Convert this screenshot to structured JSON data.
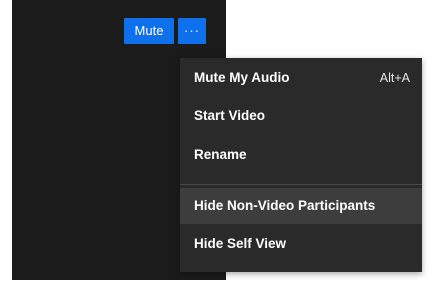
{
  "toolbar": {
    "mute_label": "Mute",
    "more_icon": "more-dots-icon",
    "more_glyph": "···"
  },
  "menu": {
    "items": [
      {
        "label": "Mute My Audio",
        "shortcut": "Alt+A",
        "highlighted": false
      },
      {
        "label": "Start Video",
        "highlighted": false
      },
      {
        "label": "Rename",
        "highlighted": false
      },
      {
        "label": "Hide Non-Video Participants",
        "highlighted": true
      },
      {
        "label": "Hide Self View",
        "highlighted": false
      }
    ]
  },
  "colors": {
    "accent": "#0e71eb",
    "menu_background": "#2a2a2b",
    "menu_highlight": "#3d3d3e",
    "tile_background": "#1b1b1c"
  }
}
